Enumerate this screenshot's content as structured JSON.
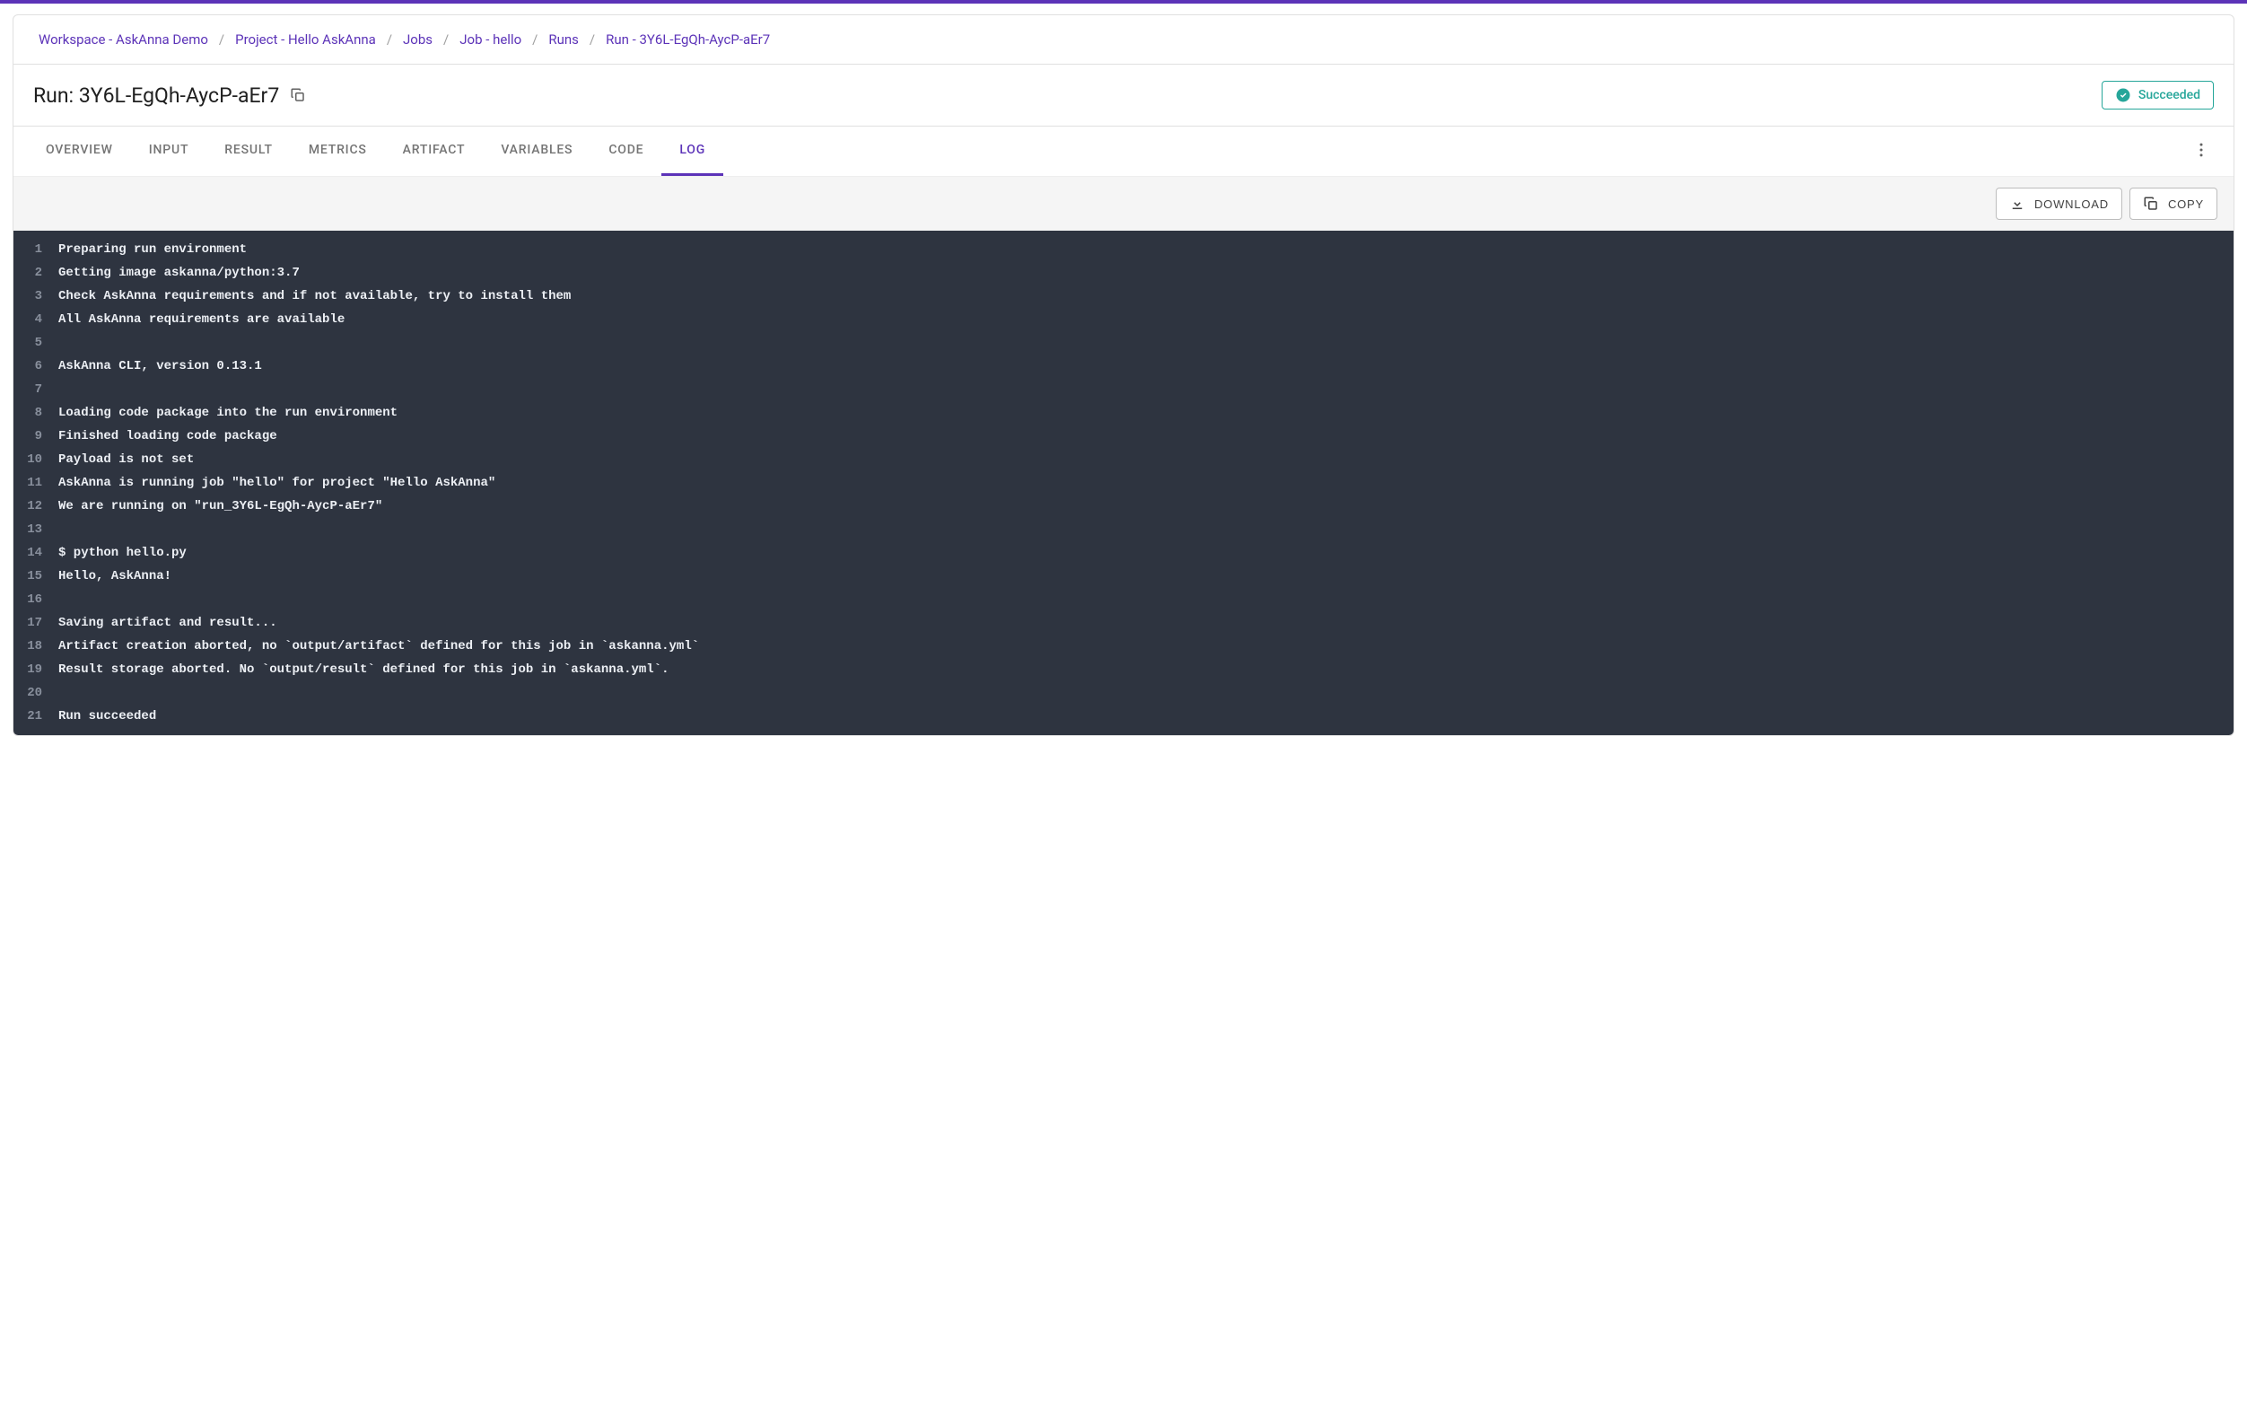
{
  "breadcrumb": [
    {
      "label": "Workspace - AskAnna Demo"
    },
    {
      "label": "Project - Hello AskAnna"
    },
    {
      "label": "Jobs"
    },
    {
      "label": "Job - hello"
    },
    {
      "label": "Runs"
    },
    {
      "label": "Run - 3Y6L-EgQh-AycP-aEr7"
    }
  ],
  "title": "Run: 3Y6L-EgQh-AycP-aEr7",
  "status": {
    "label": "Succeeded"
  },
  "tabs": [
    {
      "label": "OVERVIEW"
    },
    {
      "label": "INPUT"
    },
    {
      "label": "RESULT"
    },
    {
      "label": "METRICS"
    },
    {
      "label": "ARTIFACT"
    },
    {
      "label": "VARIABLES"
    },
    {
      "label": "CODE"
    },
    {
      "label": "LOG"
    }
  ],
  "activeTab": "LOG",
  "toolbar": {
    "download_label": "DOWNLOAD",
    "copy_label": "COPY"
  },
  "log": [
    "Preparing run environment",
    "Getting image askanna/python:3.7",
    "Check AskAnna requirements and if not available, try to install them",
    "All AskAnna requirements are available",
    "",
    "AskAnna CLI, version 0.13.1",
    "",
    "Loading code package into the run environment",
    "Finished loading code package",
    "Payload is not set",
    "AskAnna is running job \"hello\" for project \"Hello AskAnna\"",
    "We are running on \"run_3Y6L-EgQh-AycP-aEr7\"",
    "",
    "$ python hello.py",
    "Hello, AskAnna!",
    "",
    "Saving artifact and result...",
    "Artifact creation aborted, no `output/artifact` defined for this job in `askanna.yml`",
    "Result storage aborted. No `output/result` defined for this job in `askanna.yml`.",
    "",
    "Run succeeded"
  ]
}
